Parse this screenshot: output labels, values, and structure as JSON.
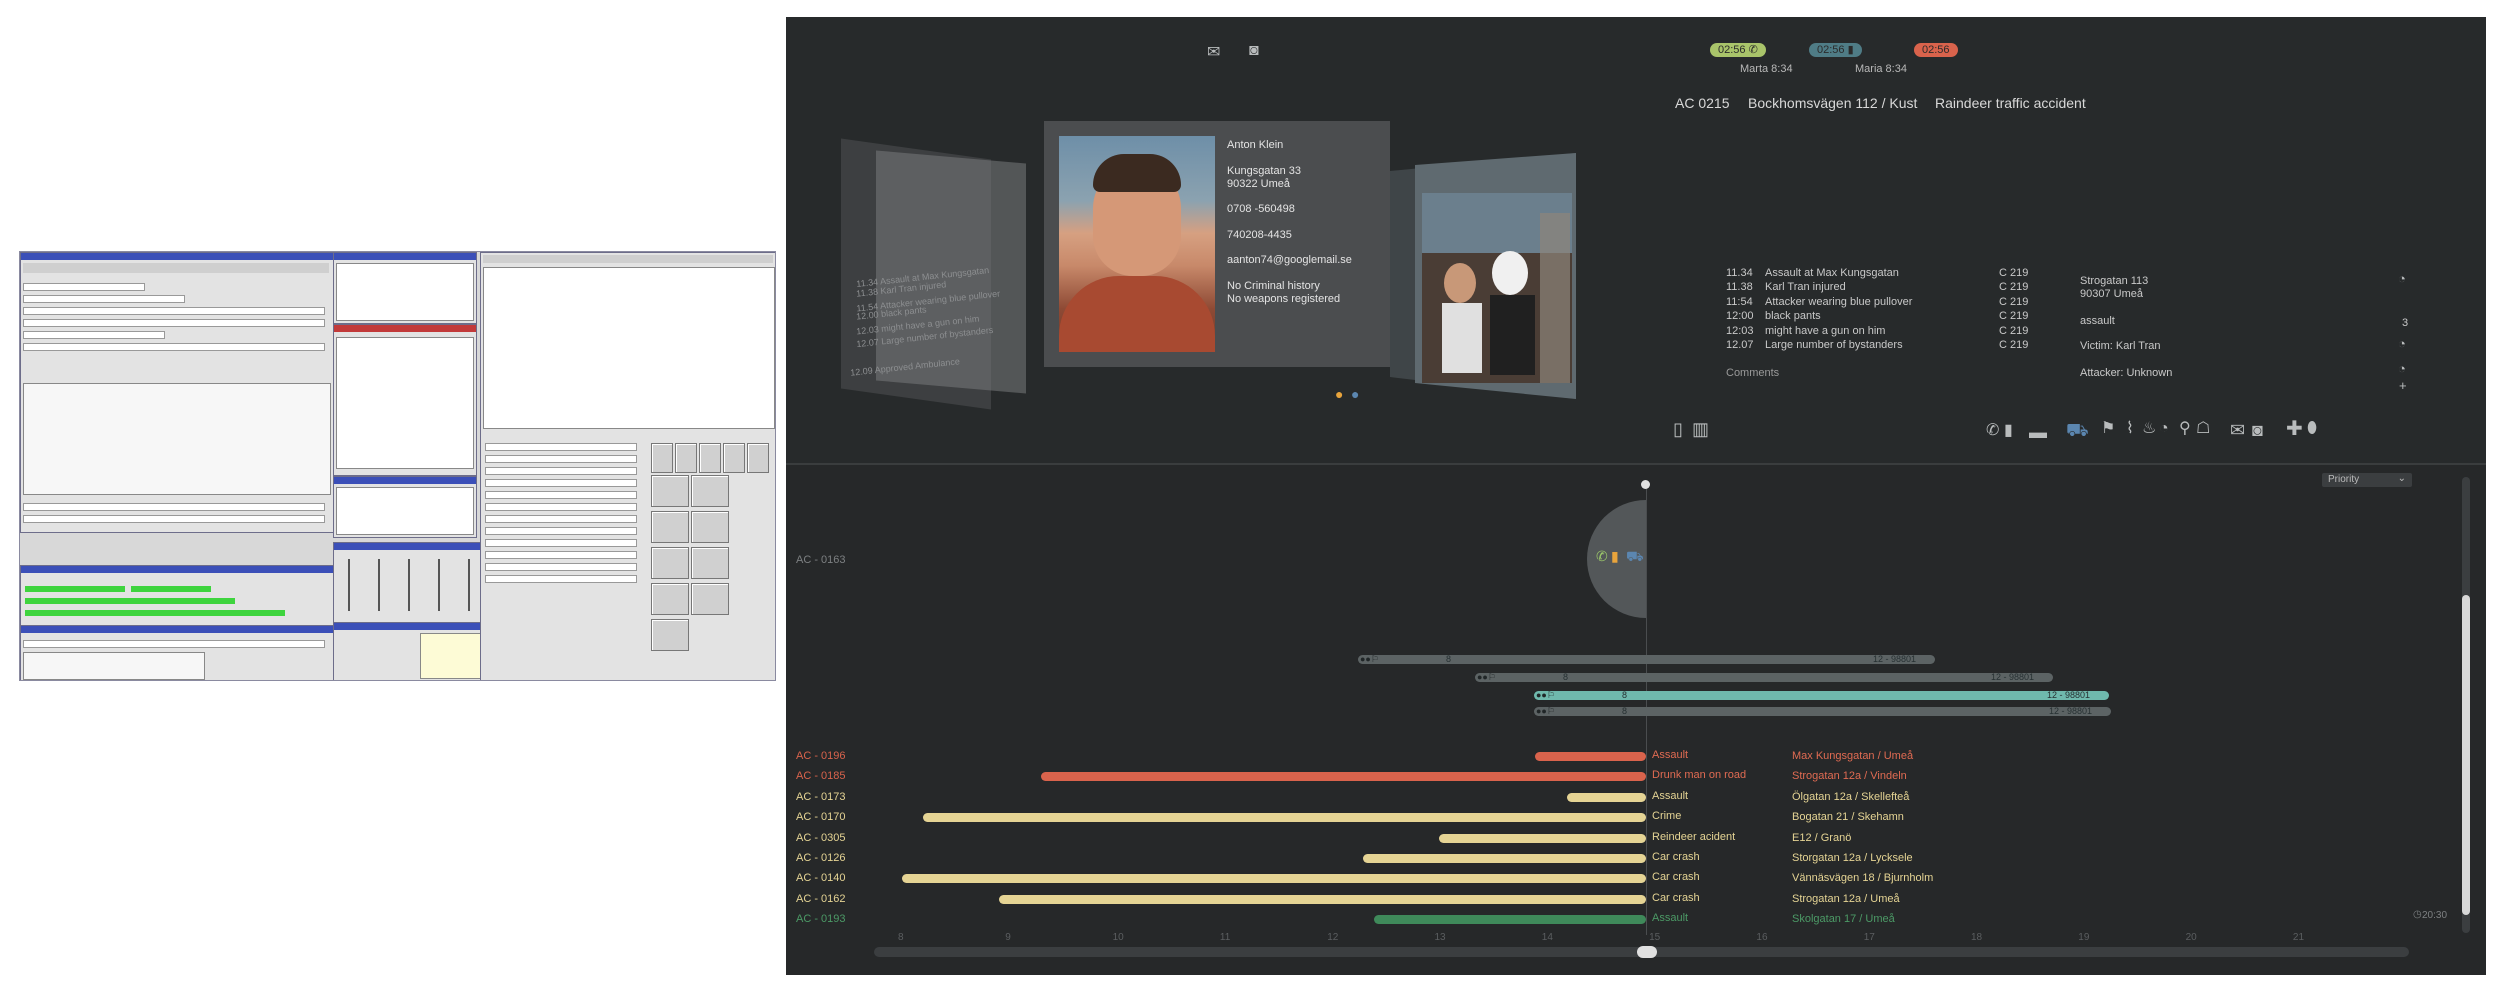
{
  "legacy": {
    "rows": [
      "",
      "",
      "",
      ""
    ]
  },
  "dash": {
    "badges": [
      {
        "text": "02:56 ✆",
        "color": "#a9c46a"
      },
      {
        "text": "02:56 ▮",
        "color": "#4f7c86"
      },
      {
        "text": "02:56",
        "color": "#d9634c"
      }
    ],
    "badge_names": [
      "Marta 8:34",
      "Maria 8:34"
    ],
    "header": {
      "case": "AC 0215",
      "address": "Bockhomsvägen  112 / Kust",
      "event": "Raindeer traffic accident"
    },
    "person": {
      "name": "Anton Klein",
      "street": "Kungsgatan 33",
      "city": "90322 Umeå",
      "phone1": "0708 -560498",
      "phone2": "740208-4435",
      "email": "aanton74@googlemail.se",
      "crime": "No Criminal history",
      "weapons": "No weapons registered"
    },
    "ghost_lines": [
      "11.34  Assault at Max Kungsgatan",
      "11.38  Karl Tran injured",
      "11.54  Attacker wearing blue pullover",
      "12.00  black pants",
      "12.03  might have a gun on him",
      "12.07  Large number of bystanders"
    ],
    "ghost_footer": "12.09  Approved Ambulance",
    "log": [
      {
        "time": "11.34",
        "text": "Assault at Max Kungsgatan",
        "code": "C 219"
      },
      {
        "time": "11.38",
        "text": "Karl Tran injured",
        "code": "C 219"
      },
      {
        "time": "11:54",
        "text": "Attacker wearing blue pullover",
        "code": "C 219"
      },
      {
        "time": "12:00",
        "text": "black pants",
        "code": "C 219"
      },
      {
        "time": "12:03",
        "text": "might have a gun on him",
        "code": "C 219"
      },
      {
        "time": "12.07",
        "text": "Large number of bystanders",
        "code": "C 219"
      }
    ],
    "comments": "Comments",
    "details": {
      "street": "Strogatan 113",
      "city": "90307 Umeå",
      "type": "assault",
      "count": "3",
      "victim": "Victim: Karl Tran",
      "attacker": "Attacker: Unknown"
    },
    "priority": "Priority",
    "pinned_label": "AC - 0163",
    "gray_bars": [
      {
        "left": "8",
        "right": "12 - 98801"
      },
      {
        "left": "8",
        "right": "12 - 98801"
      },
      {
        "left": "8",
        "right": "12 - 98801"
      },
      {
        "left": "8",
        "right": "12 - 98801"
      }
    ],
    "cases": [
      {
        "id": "AC - 0196",
        "label": "Assault",
        "location": "Max Kungsgatan / Umeå",
        "color": "#d9634c",
        "start": 13.9
      },
      {
        "id": "AC - 0185",
        "label": "Drunk man on road",
        "location": "Strogatan 12a / Vindeln",
        "color": "#d9634c",
        "start": 9.3
      },
      {
        "id": "AC - 0173",
        "label": "Assault",
        "location": "Ölgatan 12a / Skellefteå",
        "color": "#e5d494",
        "start": 14.2
      },
      {
        "id": "AC - 0170",
        "label": "Crime",
        "location": "Bogatan 21 / Skehamn",
        "color": "#e5d494",
        "start": 8.2
      },
      {
        "id": "AC - 0305",
        "label": "Reindeer acident",
        "location": "E12 / Granö",
        "color": "#e5d494",
        "start": 13.0
      },
      {
        "id": "AC - 0126",
        "label": "Car crash",
        "location": "Storgatan 12a / Lycksele",
        "color": "#e5d494",
        "start": 12.3
      },
      {
        "id": "AC - 0140",
        "label": "Car crash",
        "location": "Vännäsvägen 18 / Bjurnholm",
        "color": "#e5d494",
        "start": 8.0
      },
      {
        "id": "AC - 0162",
        "label": "Car crash",
        "location": "Strogatan 12a / Umeå",
        "color": "#e5d494",
        "start": 8.9
      },
      {
        "id": "AC - 0193",
        "label": "Assault",
        "location": "Skolgatan 17 / Umeå",
        "color": "#3f8a5a",
        "start": 12.4
      }
    ],
    "time_end": "20:30",
    "ticks": [
      "8",
      "9",
      "10",
      "11",
      "12",
      "13",
      "14",
      "15",
      "16",
      "17",
      "18",
      "19",
      "20",
      "21"
    ]
  }
}
